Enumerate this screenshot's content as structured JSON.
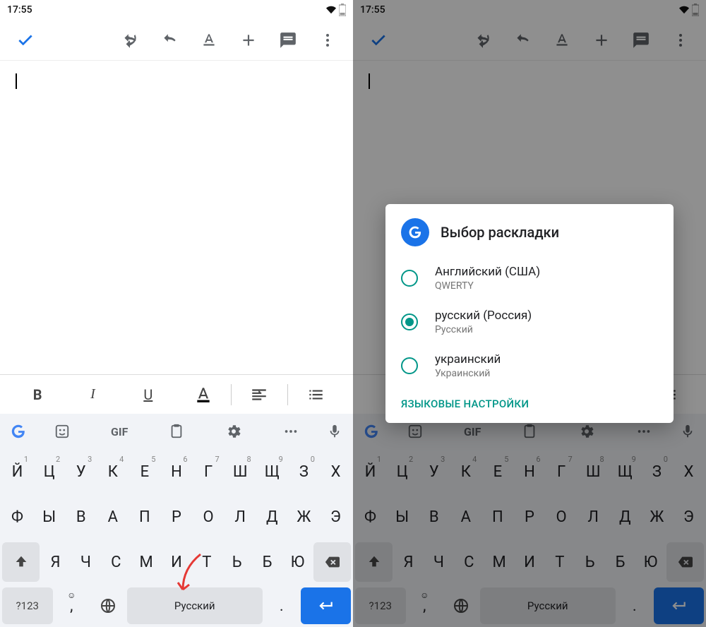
{
  "status": {
    "time": "17:55"
  },
  "toolbar": {},
  "format": {
    "bold": "B",
    "italic": "I",
    "underline": "U"
  },
  "suggest": {
    "gif": "GIF"
  },
  "keyboard": {
    "row1": [
      {
        "c": "Й",
        "n": "1"
      },
      {
        "c": "Ц",
        "n": "2"
      },
      {
        "c": "У",
        "n": "3"
      },
      {
        "c": "К",
        "n": "4"
      },
      {
        "c": "Е",
        "n": "5"
      },
      {
        "c": "Н",
        "n": "6"
      },
      {
        "c": "Г",
        "n": "7"
      },
      {
        "c": "Ш",
        "n": "8"
      },
      {
        "c": "Щ",
        "n": "9"
      },
      {
        "c": "З",
        "n": "0"
      },
      {
        "c": "Х",
        "n": ""
      }
    ],
    "row2": [
      {
        "c": "Ф"
      },
      {
        "c": "Ы"
      },
      {
        "c": "В"
      },
      {
        "c": "А"
      },
      {
        "c": "П"
      },
      {
        "c": "Р"
      },
      {
        "c": "О"
      },
      {
        "c": "Л"
      },
      {
        "c": "Д"
      },
      {
        "c": "Ж"
      },
      {
        "c": "Э"
      }
    ],
    "row3": [
      {
        "c": "Я"
      },
      {
        "c": "Ч"
      },
      {
        "c": "С"
      },
      {
        "c": "М"
      },
      {
        "c": "И"
      },
      {
        "c": "Т"
      },
      {
        "c": "Ь"
      },
      {
        "c": "Б"
      },
      {
        "c": "Ю"
      }
    ],
    "symkey": "?123",
    "comma": ",",
    "space": "Русский",
    "dot": "."
  },
  "dialog": {
    "title": "Выбор раскладки",
    "opts": [
      {
        "t": "Английский (США)",
        "s": "QWERTY",
        "sel": false
      },
      {
        "t": "русский (Россия)",
        "s": "Русский",
        "sel": true
      },
      {
        "t": "украинский",
        "s": "Украинский",
        "sel": false
      }
    ],
    "action": "ЯЗЫКОВЫЕ НАСТРОЙКИ"
  }
}
